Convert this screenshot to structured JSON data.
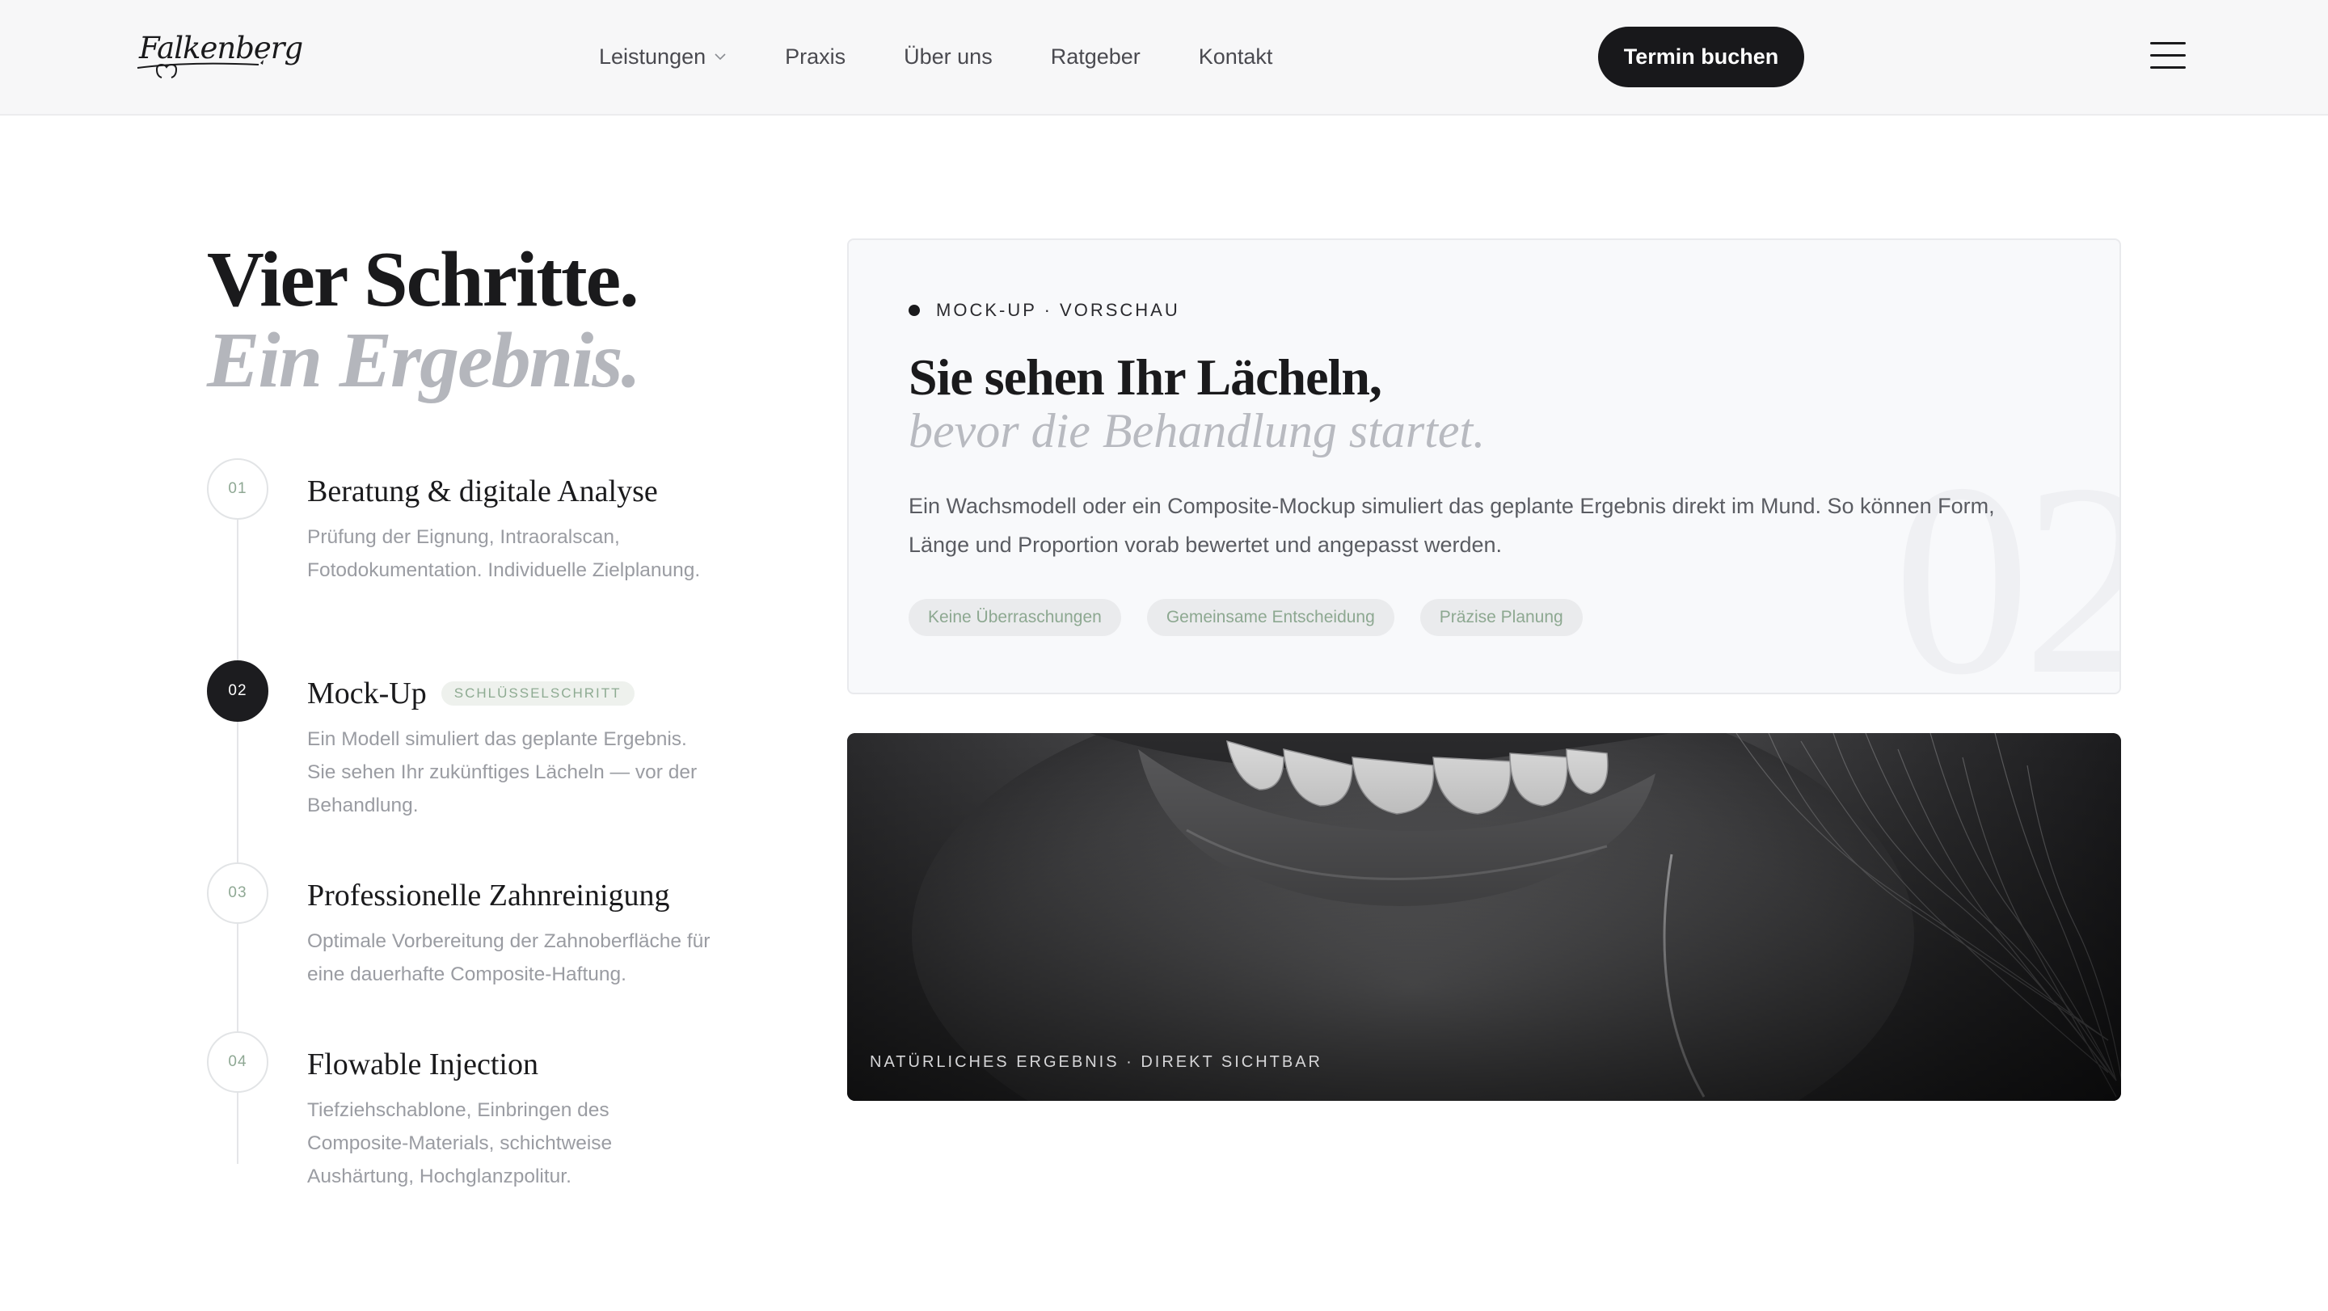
{
  "header": {
    "logo_text": "Falkenberg",
    "nav": [
      {
        "label": "Leistungen",
        "has_dropdown": true
      },
      {
        "label": "Praxis"
      },
      {
        "label": "Über uns"
      },
      {
        "label": "Ratgeber"
      },
      {
        "label": "Kontakt"
      }
    ],
    "cta_label": "Termin buchen"
  },
  "intro": {
    "heading": "Vier Schritte.",
    "heading_italic": "Ein Ergebnis."
  },
  "steps": [
    {
      "number": "01",
      "title": "Beratung & digitale Analyse",
      "description": "Prüfung der Eignung, Intraoralscan, Fotodokumentation. Individuelle Zielplanung.",
      "active": false
    },
    {
      "number": "02",
      "title": "Mock-Up",
      "badge": "SCHLÜSSELSCHRITT",
      "description": "Ein Modell simuliert das geplante Ergebnis. Sie sehen Ihr zukünftiges Lächeln — vor der Behandlung.",
      "active": true
    },
    {
      "number": "03",
      "title": "Professionelle Zahnreinigung",
      "description": "Optimale Vorbereitung der Zahnoberfläche für eine dauerhafte Composite-Haftung.",
      "active": false
    },
    {
      "number": "04",
      "title": "Flowable Injection",
      "description": "Tiefziehschablone, Einbringen des Composite-Materials, schichtweise Aushärtung, Hochglanzpolitur.",
      "active": false
    }
  ],
  "card": {
    "eyebrow": "MOCK-UP · VORSCHAU",
    "title": "Sie sehen Ihr Lächeln,",
    "subtitle": "bevor die Behandlung startet.",
    "text": "Ein Wachsmodell oder ein Composite-Mockup simuliert das geplante Ergebnis direkt im Mund. So können Form, Länge und Proportion vorab bewertet und angepasst werden.",
    "tags": [
      "Keine Überraschungen",
      "Gemeinsame Entscheidung",
      "Präzise Planung"
    ],
    "watermark": "02"
  },
  "photo": {
    "caption": "NATÜRLICHES ERGEBNIS · DIREKT SICHTBAR"
  },
  "colors": {
    "accent_dark": "#18181b",
    "accent_green": "#8eab92",
    "muted_gray": "#b4b6bc"
  }
}
